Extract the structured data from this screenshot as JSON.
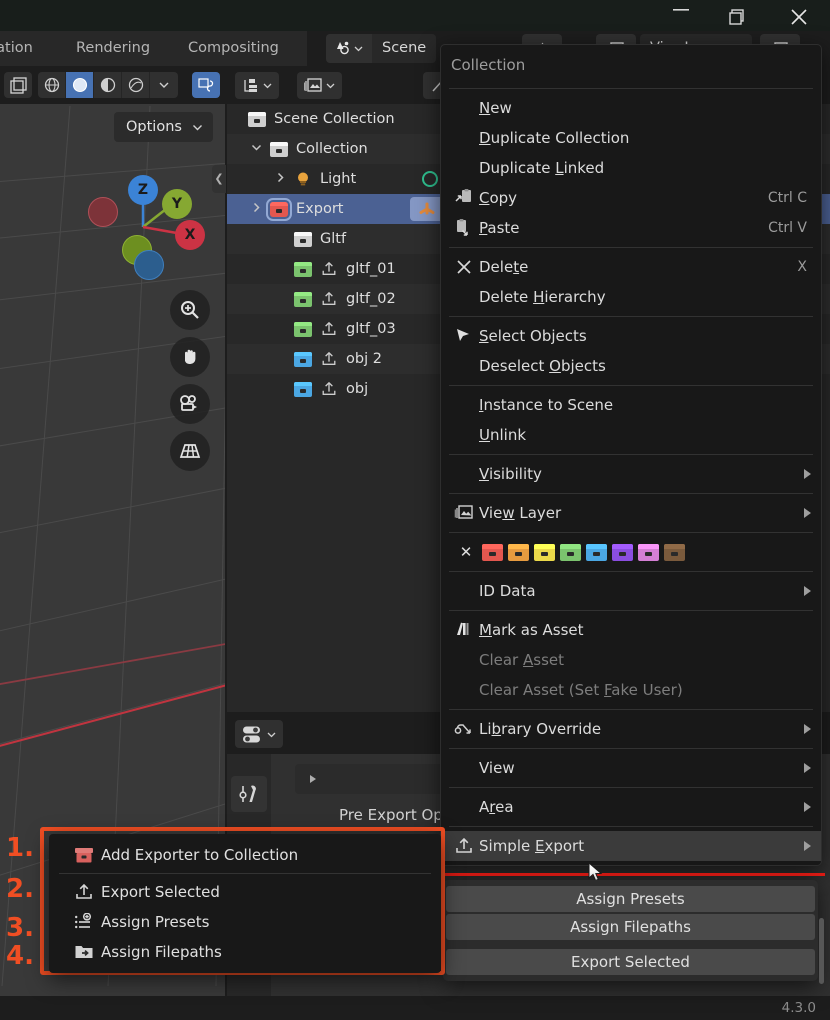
{
  "window": {
    "minimize": "minimize-button",
    "maximize": "maximize-button",
    "close": "close-button"
  },
  "topbar": {
    "workspace_tabs": [
      "mation",
      "Rendering",
      "Compositing"
    ],
    "scene_name": "Scene",
    "view_layer_name": "ViewLayer"
  },
  "viewport": {
    "options_label": "Options",
    "gizmo_axes": [
      "Z",
      "Y",
      "X"
    ],
    "tools": [
      "zoom-tool",
      "pan-tool",
      "camera-view-tool",
      "ortho-grid-tool"
    ]
  },
  "outliner": {
    "rows": [
      {
        "label": "Scene Collection",
        "indent": 14,
        "icon": "collection-icon",
        "color": "#cfcfcf",
        "disclosure": "",
        "selected": false,
        "alt": false,
        "export": false
      },
      {
        "label": "Collection",
        "indent": 38,
        "icon": "collection-icon",
        "color": "#cfcfcf",
        "disclosure": "v",
        "selected": false,
        "alt": true,
        "export": false
      },
      {
        "label": "Light",
        "indent": 62,
        "icon": "light-icon",
        "color": "#e8a33d",
        "disclosure": ">",
        "selected": false,
        "alt": false,
        "export": false
      },
      {
        "label": "Export",
        "indent": 38,
        "icon": "collection-icon",
        "color": "#e3574f",
        "disclosure": ">",
        "selected": true,
        "alt": false,
        "export": false
      },
      {
        "label": "Gltf",
        "indent": 62,
        "icon": "collection-icon",
        "color": "#cfcfcf",
        "disclosure": "",
        "selected": false,
        "alt": true,
        "export": false
      },
      {
        "label": "gltf_01",
        "indent": 62,
        "icon": "collection-icon",
        "color": "#7bc36e",
        "disclosure": "",
        "selected": false,
        "alt": false,
        "export": true
      },
      {
        "label": "gltf_02",
        "indent": 62,
        "icon": "collection-icon",
        "color": "#7bc36e",
        "disclosure": "",
        "selected": false,
        "alt": true,
        "export": true
      },
      {
        "label": "gltf_03",
        "indent": 62,
        "icon": "collection-icon",
        "color": "#7bc36e",
        "disclosure": "",
        "selected": false,
        "alt": false,
        "export": true
      },
      {
        "label": "obj 2",
        "indent": 62,
        "icon": "collection-icon",
        "color": "#4ba7e3",
        "disclosure": "",
        "selected": false,
        "alt": true,
        "export": true
      },
      {
        "label": "obj",
        "indent": 62,
        "icon": "collection-icon",
        "color": "#4ba7e3",
        "disclosure": "",
        "selected": false,
        "alt": false,
        "export": true
      }
    ]
  },
  "properties": {
    "panel_label": "Pre Export Opera"
  },
  "context_menu": {
    "title": "Collection",
    "items": [
      {
        "label": "New",
        "accel": "N",
        "icon": "",
        "key": "",
        "arrow": false,
        "dim": false,
        "sep_after": false
      },
      {
        "label": "Duplicate Collection",
        "accel": "D",
        "icon": "",
        "key": "",
        "arrow": false,
        "dim": false,
        "sep_after": false
      },
      {
        "label": "Duplicate Linked",
        "accel": "L",
        "icon": "",
        "key": "",
        "arrow": false,
        "dim": false,
        "sep_after": false
      },
      {
        "label": "Copy",
        "accel": "C",
        "icon": "copy-icon",
        "key": "Ctrl C",
        "arrow": false,
        "dim": false,
        "sep_after": false
      },
      {
        "label": "Paste",
        "accel": "P",
        "icon": "paste-icon",
        "key": "Ctrl V",
        "arrow": false,
        "dim": false,
        "sep_after": true
      },
      {
        "label": "Delete",
        "accel": "t",
        "icon": "x-icon",
        "key": "X",
        "arrow": false,
        "dim": false,
        "sep_after": false
      },
      {
        "label": "Delete Hierarchy",
        "accel": "H",
        "icon": "",
        "key": "",
        "arrow": false,
        "dim": false,
        "sep_after": true
      },
      {
        "label": "Select Objects",
        "accel": "S",
        "icon": "cursor-arrow-icon",
        "key": "",
        "arrow": false,
        "dim": false,
        "sep_after": false
      },
      {
        "label": "Deselect Objects",
        "accel": "O",
        "icon": "",
        "key": "",
        "arrow": false,
        "dim": false,
        "sep_after": true
      },
      {
        "label": "Instance to Scene",
        "accel": "I",
        "icon": "",
        "key": "",
        "arrow": false,
        "dim": false,
        "sep_after": false
      },
      {
        "label": "Unlink",
        "accel": "U",
        "icon": "",
        "key": "",
        "arrow": false,
        "dim": false,
        "sep_after": true
      },
      {
        "label": "Visibility",
        "accel": "V",
        "icon": "",
        "key": "",
        "arrow": true,
        "dim": false,
        "sep_after": true
      },
      {
        "label": "View Layer",
        "accel": "w",
        "icon": "view-layer-icon",
        "key": "",
        "arrow": true,
        "dim": false,
        "sep_after": true
      }
    ],
    "color_swatches": {
      "none_label": "✕",
      "colors": [
        "#e3574f",
        "#e79b3f",
        "#ebd94a",
        "#7bc36e",
        "#4ba7e3",
        "#8b4ee0",
        "#d47fd4",
        "#7a5a3c"
      ]
    },
    "items2": [
      {
        "label": "ID Data",
        "accel": "",
        "icon": "",
        "key": "",
        "arrow": true,
        "dim": false,
        "sep_after": true
      },
      {
        "label": "Mark as Asset",
        "accel": "M",
        "icon": "asset-icon",
        "key": "",
        "arrow": false,
        "dim": false,
        "sep_after": false
      },
      {
        "label": "Clear Asset",
        "accel": "A",
        "icon": "",
        "key": "",
        "arrow": false,
        "dim": true,
        "sep_after": false
      },
      {
        "label": "Clear Asset (Set Fake User)",
        "accel": "F",
        "icon": "",
        "key": "",
        "arrow": false,
        "dim": true,
        "sep_after": true
      },
      {
        "label": "Library Override",
        "accel": "b",
        "icon": "library-override-icon",
        "key": "",
        "arrow": true,
        "dim": false,
        "sep_after": true
      },
      {
        "label": "View",
        "accel": "",
        "icon": "",
        "key": "",
        "arrow": true,
        "dim": false,
        "sep_after": true
      },
      {
        "label": "Area",
        "accel": "r",
        "icon": "",
        "key": "",
        "arrow": true,
        "dim": false,
        "sep_after": true
      },
      {
        "label": "Simple Export",
        "accel": "E",
        "icon": "export-icon",
        "key": "",
        "arrow": true,
        "dim": false,
        "sep_after": false,
        "highlighted": true
      }
    ]
  },
  "submenu": {
    "items": [
      "Assign Presets",
      "Assign Filepaths"
    ],
    "items_group2": [
      "Export Selected"
    ]
  },
  "annotated_menu": {
    "numbers": [
      "1.",
      "2.",
      "3.",
      "4."
    ],
    "items": [
      {
        "label": "Add Exporter to Collection",
        "accel": "A",
        "icon": "collection-red-icon"
      },
      {
        "label": "Export Selected",
        "accel": "E",
        "icon": "export-icon"
      },
      {
        "label": "Assign Presets",
        "accel": "P",
        "icon": "presets-icon"
      },
      {
        "label": "Assign Filepaths",
        "accel": "F",
        "icon": "filepath-icon"
      }
    ],
    "highlight_color": "#f04e23"
  },
  "statusbar": {
    "version": "4.3.0"
  }
}
